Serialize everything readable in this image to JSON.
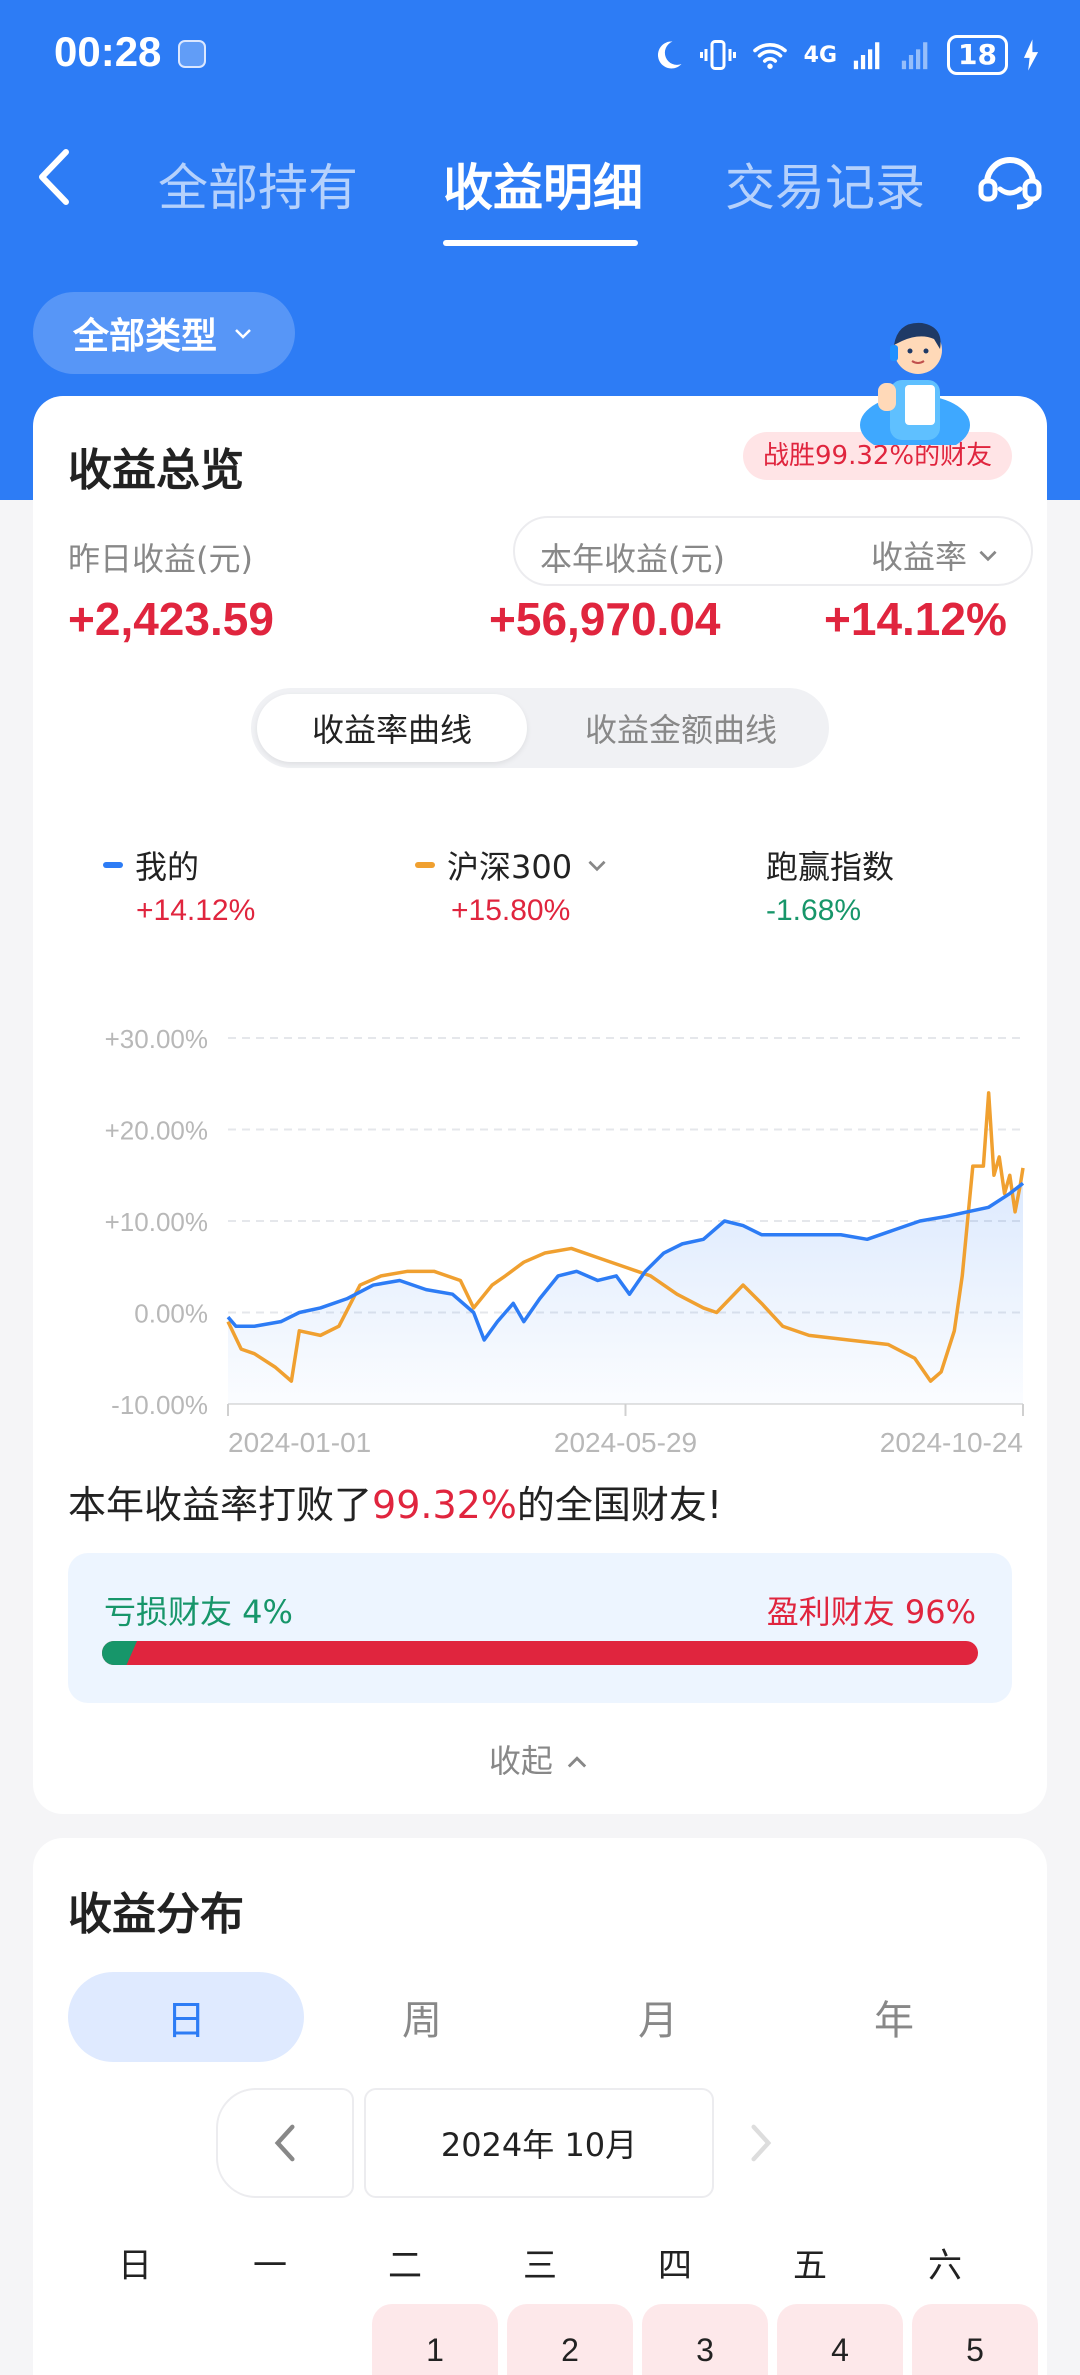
{
  "status_bar": {
    "time": "00:28",
    "signal_label": "4G",
    "battery": "18"
  },
  "nav": {
    "tabs": [
      "全部持有",
      "收益明细",
      "交易记录"
    ],
    "active_tab": "收益明细"
  },
  "filter": {
    "label": "全部类型"
  },
  "overview": {
    "title": "收益总览",
    "rank_badge": "战胜99.32%的财友",
    "yesterday_label": "昨日收益(元)",
    "yesterday_value": "+2,423.59",
    "year_label": "本年收益(元)",
    "year_value": "+56,970.04",
    "rate_label": "收益率",
    "rate_value": "+14.12%",
    "curve_tabs": [
      "收益率曲线",
      "收益金额曲线"
    ],
    "active_curve": "收益率曲线"
  },
  "legend": [
    {
      "name": "我的",
      "value": "+14.12%",
      "color": "#2d7cf5",
      "value_color": "#e0253e"
    },
    {
      "name": "沪深300",
      "value": "+15.80%",
      "color": "#f0a030",
      "value_color": "#e0253e"
    },
    {
      "name": "跑赢指数",
      "value": "-1.68%",
      "color": "",
      "value_color": "#17966a"
    }
  ],
  "chart_data": {
    "type": "line",
    "y_ticks": [
      "+30.00%",
      "+20.00%",
      "+10.00%",
      "0.00%",
      "-10.00%"
    ],
    "x_ticks": [
      "2024-01-01",
      "2024-05-29",
      "2024-10-24"
    ],
    "ylim": [
      -10,
      30
    ],
    "grid": true,
    "series": [
      {
        "name": "我的",
        "color": "#2d7cf5",
        "points": [
          [
            0,
            -0.5
          ],
          [
            3,
            -1.5
          ],
          [
            10,
            -1.5
          ],
          [
            20,
            -1
          ],
          [
            27,
            0
          ],
          [
            35,
            0.5
          ],
          [
            45,
            1.5
          ],
          [
            55,
            3
          ],
          [
            65,
            3.5
          ],
          [
            75,
            2.5
          ],
          [
            85,
            2
          ],
          [
            93,
            0
          ],
          [
            97,
            -3
          ],
          [
            102,
            -1
          ],
          [
            108,
            1
          ],
          [
            112,
            -1
          ],
          [
            118,
            1.5
          ],
          [
            125,
            4
          ],
          [
            132,
            4.5
          ],
          [
            140,
            3.5
          ],
          [
            147,
            4
          ],
          [
            152,
            2
          ],
          [
            158,
            4.5
          ],
          [
            165,
            6.5
          ],
          [
            172,
            7.5
          ],
          [
            180,
            8
          ],
          [
            188,
            10
          ],
          [
            195,
            9.5
          ],
          [
            202,
            8.5
          ],
          [
            212,
            8.5
          ],
          [
            222,
            8.5
          ],
          [
            232,
            8.5
          ],
          [
            242,
            8
          ],
          [
            252,
            9
          ],
          [
            262,
            10
          ],
          [
            272,
            10.5
          ],
          [
            280,
            11
          ],
          [
            288,
            11.5
          ],
          [
            296,
            13
          ],
          [
            301,
            14.12
          ]
        ]
      },
      {
        "name": "沪深300",
        "color": "#f0a030",
        "points": [
          [
            0,
            -1
          ],
          [
            5,
            -4
          ],
          [
            10,
            -4.5
          ],
          [
            18,
            -6
          ],
          [
            24,
            -7.5
          ],
          [
            27,
            -2
          ],
          [
            35,
            -2.5
          ],
          [
            42,
            -1.5
          ],
          [
            50,
            3
          ],
          [
            58,
            4
          ],
          [
            68,
            4.5
          ],
          [
            78,
            4.5
          ],
          [
            88,
            3.5
          ],
          [
            93,
            0.5
          ],
          [
            100,
            3
          ],
          [
            105,
            4
          ],
          [
            112,
            5.5
          ],
          [
            120,
            6.5
          ],
          [
            130,
            7
          ],
          [
            140,
            6
          ],
          [
            150,
            5
          ],
          [
            160,
            4
          ],
          [
            170,
            2
          ],
          [
            180,
            0.5
          ],
          [
            185,
            0
          ],
          [
            195,
            3
          ],
          [
            202,
            1
          ],
          [
            210,
            -1.5
          ],
          [
            220,
            -2.5
          ],
          [
            235,
            -3
          ],
          [
            250,
            -3.5
          ],
          [
            260,
            -5
          ],
          [
            266,
            -7.5
          ],
          [
            270,
            -6.5
          ],
          [
            275,
            -2
          ],
          [
            278,
            4
          ],
          [
            280,
            10
          ],
          [
            282,
            16
          ],
          [
            286,
            16
          ],
          [
            288,
            24
          ],
          [
            290,
            15
          ],
          [
            292,
            17
          ],
          [
            294,
            13
          ],
          [
            296,
            15
          ],
          [
            298,
            11
          ],
          [
            300,
            14
          ],
          [
            301,
            15.8
          ]
        ]
      }
    ]
  },
  "beat_text": {
    "prefix": "本年收益率打败了",
    "highlight": "99.32%",
    "suffix": "的全国财友!"
  },
  "distribution_bar": {
    "loss_label": "亏损财友 4%",
    "gain_label": "盈利财友 96%",
    "loss_fraction": 0.04
  },
  "collapse_label": "收起",
  "income_dist": {
    "title": "收益分布",
    "periods": [
      "日",
      "周",
      "月",
      "年"
    ],
    "active_period": "日",
    "month_label": "2024年 10月",
    "weekdays": [
      "日",
      "一",
      "二",
      "三",
      "四",
      "五",
      "六"
    ],
    "days": [
      "1",
      "2",
      "3",
      "4",
      "5"
    ]
  }
}
